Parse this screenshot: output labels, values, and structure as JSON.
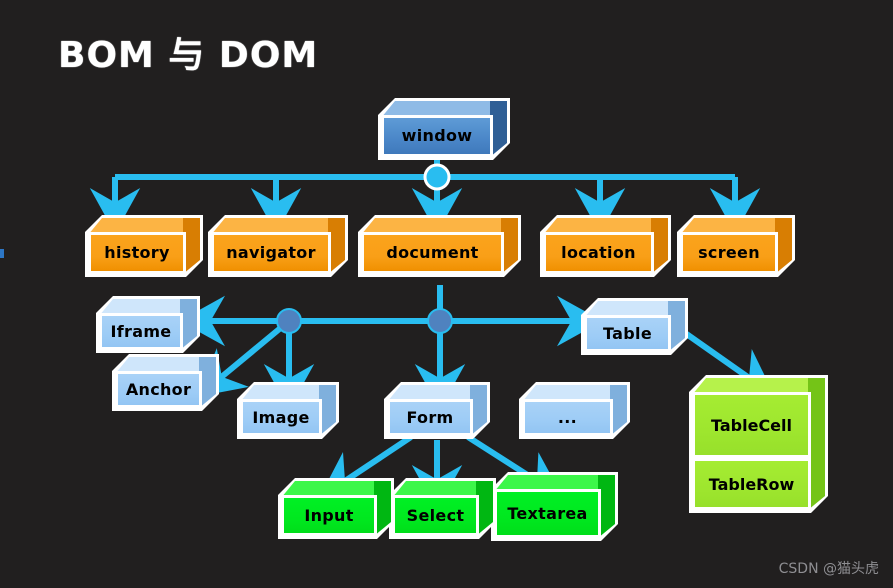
{
  "slide": {
    "title": "BOM 与 DOM",
    "background_color": "#211f1f",
    "title_color": "#ffffff",
    "watermark": "CSDN @猫头虎"
  },
  "colors": {
    "connector": "#29bdf0",
    "node_root": "#29bdf0",
    "node_branch": "#4f82bf",
    "box_blue": "#4a86c8",
    "box_orange": "#f99f17",
    "box_light_blue": "#9dccf6",
    "box_green": "#00e81f",
    "box_yellow_green": "#9ee62e",
    "outline": "#ffffff",
    "text": "#000000"
  },
  "diagram": {
    "type": "tree",
    "root": {
      "label": "window",
      "color": "#4a86c8"
    },
    "bom_level": [
      {
        "label": "history",
        "color": "#f99f17"
      },
      {
        "label": "navigator",
        "color": "#f99f17"
      },
      {
        "label": "document",
        "color": "#f99f17"
      },
      {
        "label": "location",
        "color": "#f99f17"
      },
      {
        "label": "screen",
        "color": "#f99f17"
      }
    ],
    "dom_level": [
      {
        "label": "Iframe",
        "color": "#9dccf6"
      },
      {
        "label": "Anchor",
        "color": "#9dccf6"
      },
      {
        "label": "Image",
        "color": "#9dccf6"
      },
      {
        "label": "Form",
        "color": "#9dccf6"
      },
      {
        "label": "...",
        "color": "#9dccf6"
      },
      {
        "label": "Table",
        "color": "#9dccf6"
      }
    ],
    "form_children": [
      {
        "label": "Input",
        "color": "#00e81f"
      },
      {
        "label": "Select",
        "color": "#00e81f"
      },
      {
        "label": "Textarea",
        "color": "#00e81f"
      }
    ],
    "table_children": [
      {
        "label": "TableCell",
        "color": "#9ee62e"
      },
      {
        "label": "TableRow",
        "color": "#9ee62e"
      }
    ],
    "edges": [
      {
        "from": "window",
        "to": "history"
      },
      {
        "from": "window",
        "to": "navigator"
      },
      {
        "from": "window",
        "to": "document"
      },
      {
        "from": "window",
        "to": "location"
      },
      {
        "from": "window",
        "to": "screen"
      },
      {
        "from": "document",
        "to": "Iframe"
      },
      {
        "from": "document",
        "to": "Anchor"
      },
      {
        "from": "document",
        "to": "Image"
      },
      {
        "from": "document",
        "to": "Form"
      },
      {
        "from": "document",
        "to": "Table"
      },
      {
        "from": "Form",
        "to": "Input"
      },
      {
        "from": "Form",
        "to": "Select"
      },
      {
        "from": "Form",
        "to": "Textarea"
      },
      {
        "from": "Table",
        "to": "TableCell"
      }
    ]
  }
}
